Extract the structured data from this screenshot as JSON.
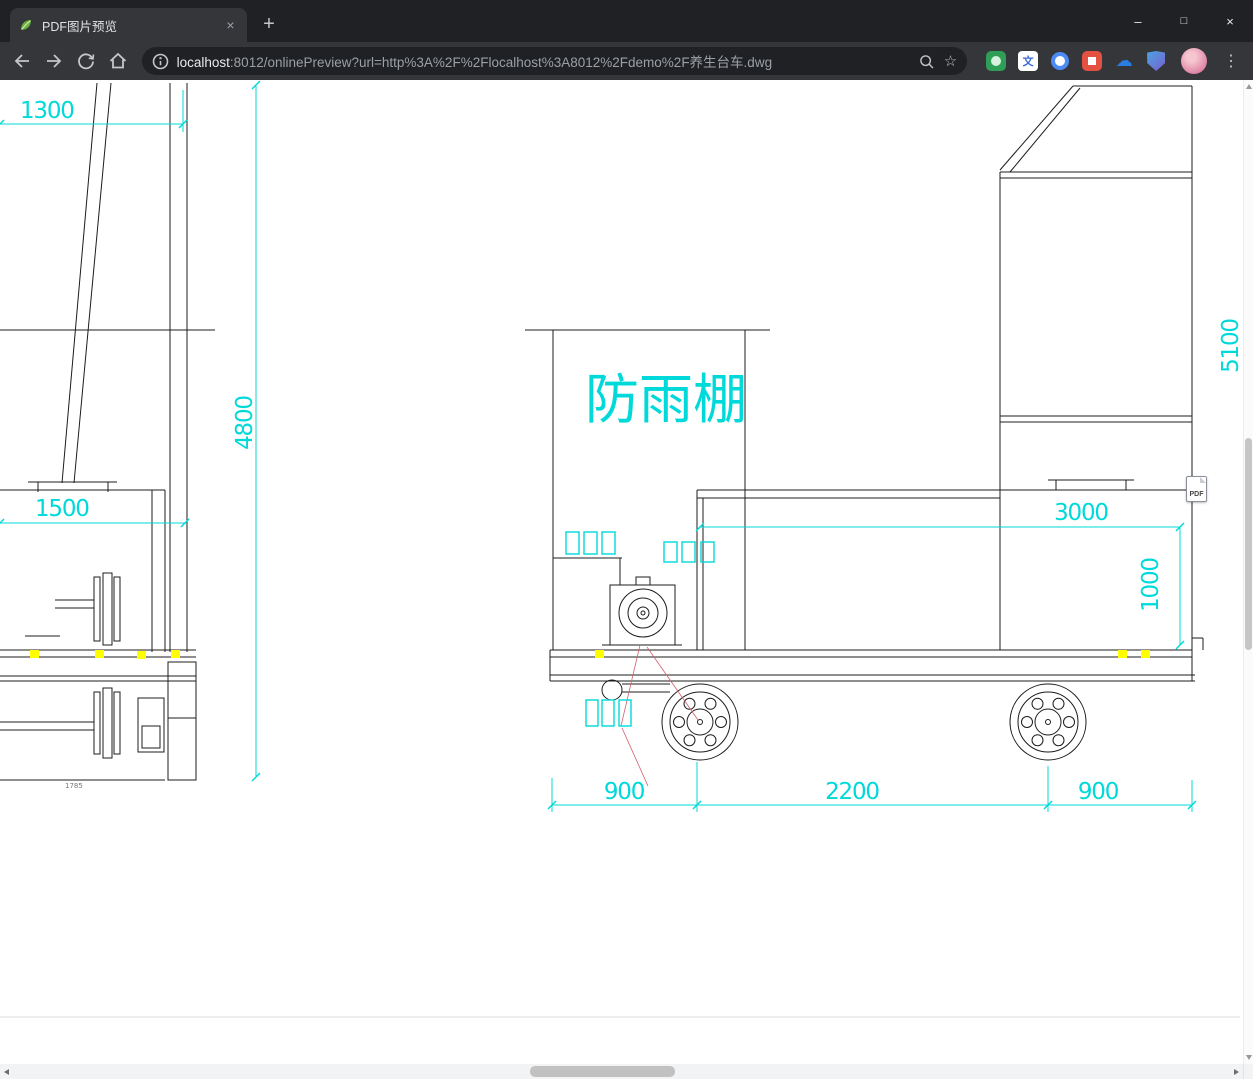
{
  "window": {
    "tab_title": "PDF图片预览",
    "controls": {
      "minimize": "–",
      "maximize": "□",
      "close": "×"
    }
  },
  "icons": {
    "new_tab_glyph": "+",
    "tab_close_glyph": "×",
    "menu_glyph": "⋮",
    "star_glyph": "☆",
    "cloud_glyph": "☁",
    "translate_glyph": "文"
  },
  "toolbar": {
    "url_host": "localhost",
    "url_rest": ":8012/onlinePreview?url=http%3A%2F%2Flocalhost%3A8012%2Fdemo%2F养生台车.dwg"
  },
  "drawing": {
    "shelter_label": "防雨棚",
    "pdf_badge": "PDF",
    "dims": {
      "d1300": "1300",
      "d4800": "4800",
      "d1500": "1500",
      "d5100": "5100",
      "d3000": "3000",
      "d1000": "1000",
      "d900_left": "900",
      "d2200": "2200",
      "d900_right": "900",
      "d1785": "1785"
    },
    "colors": {
      "dimension_cyan": "#00d9d9",
      "line_black": "#1c1c1c",
      "highlight_yellow": "#ffff00"
    }
  }
}
